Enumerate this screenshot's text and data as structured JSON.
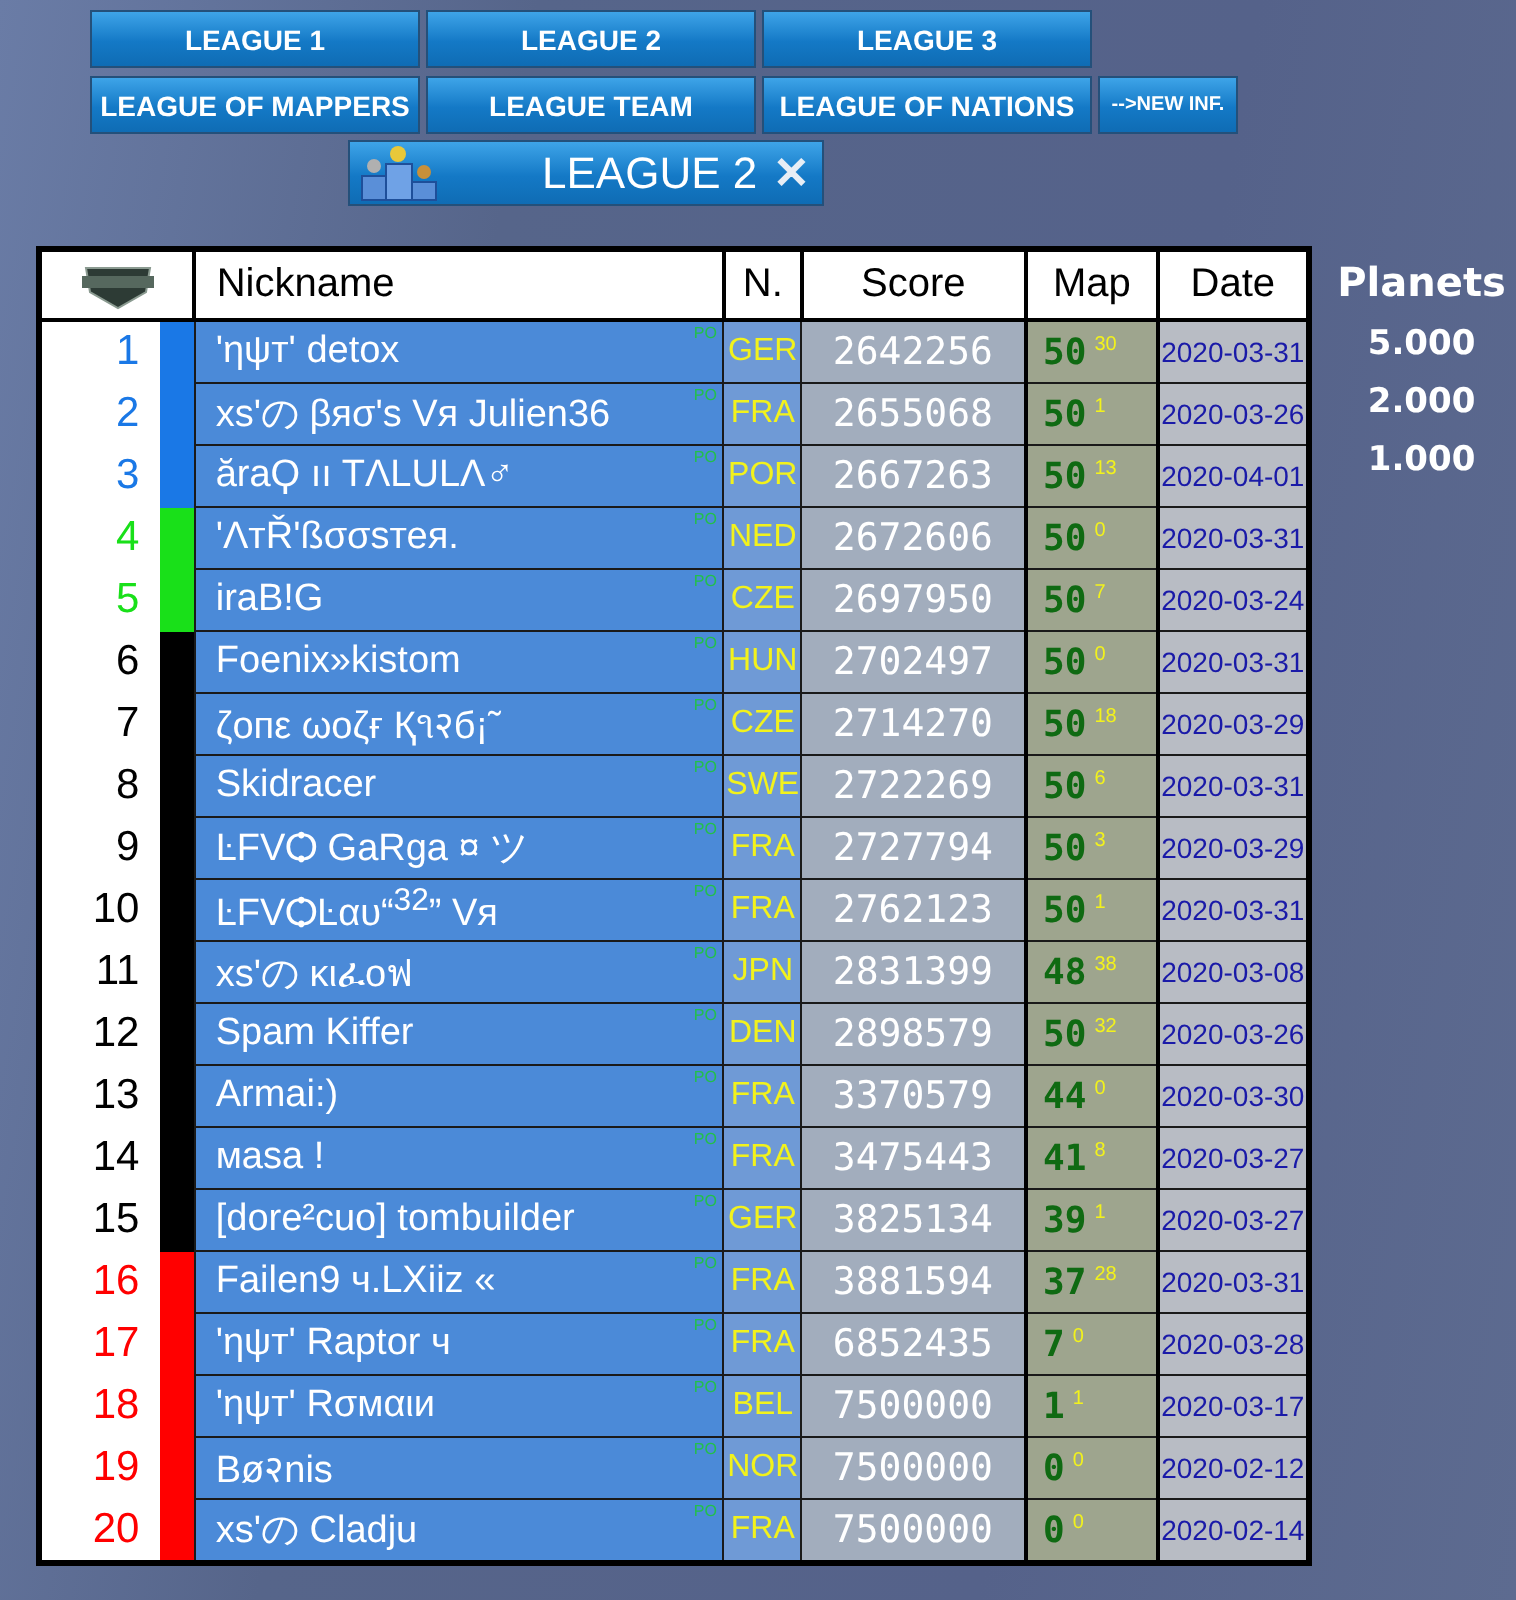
{
  "league_buttons": [
    {
      "label": "LEAGUE 1"
    },
    {
      "label": "LEAGUE 2"
    },
    {
      "label": "LEAGUE 3"
    },
    {
      "label": "LEAGUE OF MAPPERS"
    },
    {
      "label": "LEAGUE TEAM"
    },
    {
      "label": "LEAGUE OF NATIONS"
    },
    {
      "label": "-->NEW INF.",
      "kind": "small"
    }
  ],
  "current_league": {
    "label": "LEAGUE 2",
    "close": "✕"
  },
  "table": {
    "columns": [
      "Nickname",
      "N.",
      "Score",
      "Map",
      "Date"
    ],
    "rows": [
      {
        "rank": "1",
        "color": "#1a78e6",
        "nickname": "'ηψт' detox",
        "po": "PO",
        "nation": "GER",
        "score": "2642256",
        "map": "50",
        "map_extra": "30",
        "date": "2020-03-31"
      },
      {
        "rank": "2",
        "color": "#1a78e6",
        "nickname": "xs'の βяσ's Vя Julien36",
        "po": "PO",
        "nation": "FRA",
        "score": "2655068",
        "map": "50",
        "map_extra": "1",
        "date": "2020-03-26"
      },
      {
        "rank": "3",
        "color": "#1a78e6",
        "nickname": "ăraϘ ıı TΛLULΛ♂",
        "po": "PO",
        "nation": "POR",
        "score": "2667263",
        "map": "50",
        "map_extra": "13",
        "date": "2020-04-01"
      },
      {
        "rank": "4",
        "color": "#19e019",
        "nickname": "'ΛтŘ'ßσσsтея.",
        "po": "PO",
        "nation": "NED",
        "score": "2672606",
        "map": "50",
        "map_extra": "0",
        "date": "2020-03-31"
      },
      {
        "rank": "5",
        "color": "#19e019",
        "nickname": "iraB!G",
        "po": "PO",
        "nation": "CZE",
        "score": "2697950",
        "map": "50",
        "map_extra": "7",
        "date": "2020-03-24"
      },
      {
        "rank": "6",
        "color": "#000000",
        "nickname": "Foenix»kistom",
        "po": "PO",
        "nation": "HUN",
        "score": "2702497",
        "map": "50",
        "map_extra": "0",
        "date": "2020-03-31"
      },
      {
        "rank": "7",
        "color": "#000000",
        "nickname": "ζопε ωoζғ Қ૧२б¡˜",
        "po": "PO",
        "nation": "CZE",
        "score": "2714270",
        "map": "50",
        "map_extra": "18",
        "date": "2020-03-29"
      },
      {
        "rank": "8",
        "color": "#000000",
        "nickname": "Skidracer",
        "po": "PO",
        "nation": "SWE",
        "score": "2722269",
        "map": "50",
        "map_extra": "6",
        "date": "2020-03-31"
      },
      {
        "rank": "9",
        "color": "#000000",
        "nickname": "ĿFVѺ GaRga ¤ ツ",
        "po": "PO",
        "nation": "FRA",
        "score": "2727794",
        "map": "50",
        "map_extra": "3",
        "date": "2020-03-29"
      },
      {
        "rank": "10",
        "color": "#000000",
        "nickname": "ĿFVѺĿαυ“$^{32}$” Vя",
        "po": "PO",
        "nation": "FRA",
        "score": "2762123",
        "map": "50",
        "map_extra": "1",
        "date": "2020-03-31"
      },
      {
        "rank": "11",
        "color": "#000000",
        "nickname": "xs'の κιፈoฟ",
        "po": "PO",
        "nation": "JPN",
        "score": "2831399",
        "map": "48",
        "map_extra": "38",
        "date": "2020-03-08"
      },
      {
        "rank": "12",
        "color": "#000000",
        "nickname": "Spam  Kiffer",
        "po": "PO",
        "nation": "DEN",
        "score": "2898579",
        "map": "50",
        "map_extra": "32",
        "date": "2020-03-26"
      },
      {
        "rank": "13",
        "color": "#000000",
        "nickname": "Armai:)",
        "po": "PO",
        "nation": "FRA",
        "score": "3370579",
        "map": "44",
        "map_extra": "0",
        "date": "2020-03-30"
      },
      {
        "rank": "14",
        "color": "#000000",
        "nickname": "мasa !",
        "po": "PO",
        "nation": "FRA",
        "score": "3475443",
        "map": "41",
        "map_extra": "8",
        "date": "2020-03-27"
      },
      {
        "rank": "15",
        "color": "#000000",
        "nickname": "[dore²cuo] tombuilder",
        "po": "PO",
        "nation": "GER",
        "score": "3825134",
        "map": "39",
        "map_extra": "1",
        "date": "2020-03-27"
      },
      {
        "rank": "16",
        "color": "#ff0000",
        "nickname": "Failen9 ч.LXiiz «",
        "po": "PO",
        "nation": "FRA",
        "score": "3881594",
        "map": "37",
        "map_extra": "28",
        "date": "2020-03-31"
      },
      {
        "rank": "17",
        "color": "#ff0000",
        "nickname": "'ηψт' Raptor ч",
        "po": "PO",
        "nation": "FRA",
        "score": "6852435",
        "map": "7",
        "map_extra": "0",
        "date": "2020-03-28"
      },
      {
        "rank": "18",
        "color": "#ff0000",
        "nickname": "'ηψт' Rσмαιи",
        "po": "PO",
        "nation": "BEL",
        "score": "7500000",
        "map": "1",
        "map_extra": "1",
        "date": "2020-03-17"
      },
      {
        "rank": "19",
        "color": "#ff0000",
        "nickname": "Bø२nis",
        "po": "PO",
        "nation": "NOR",
        "score": "7500000",
        "map": "0",
        "map_extra": "0",
        "date": "2020-02-12"
      },
      {
        "rank": "20",
        "color": "#ff0000",
        "nickname": "xs'の Cladju",
        "po": "PO",
        "nation": "FRA",
        "score": "7500000",
        "map": "0",
        "map_extra": "0",
        "date": "2020-02-14"
      }
    ]
  },
  "planets": {
    "title": "Planets",
    "values": [
      "5.000",
      "2.000",
      "1.000"
    ]
  }
}
